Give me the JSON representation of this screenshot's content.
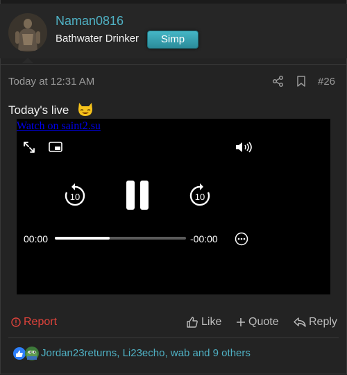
{
  "post": {
    "username": "Naman0816",
    "user_title": "Bathwater Drinker",
    "badge_label": "Simp",
    "timestamp": "Today at 12:31 AM",
    "post_number": "#26",
    "message_text": "Today's live",
    "emoji": "smiling-cat-emoji"
  },
  "video": {
    "link_text": "Watch on saint2.su",
    "time_elapsed": "00:00",
    "time_remaining": "-00:00",
    "progress_fraction": 0.42,
    "rewind_seconds": "10",
    "forward_seconds": "10"
  },
  "actions": {
    "report_label": "Report",
    "like_label": "Like",
    "quote_label": "Quote",
    "reply_label": "Reply"
  },
  "reactions": {
    "summary_text": "Jordan23returns, Li23echo, wab and 9 others"
  },
  "colors": {
    "background": "#232323",
    "accent": "#4fb1c4",
    "report": "#e0433b",
    "badge": "#3aa7b6"
  }
}
